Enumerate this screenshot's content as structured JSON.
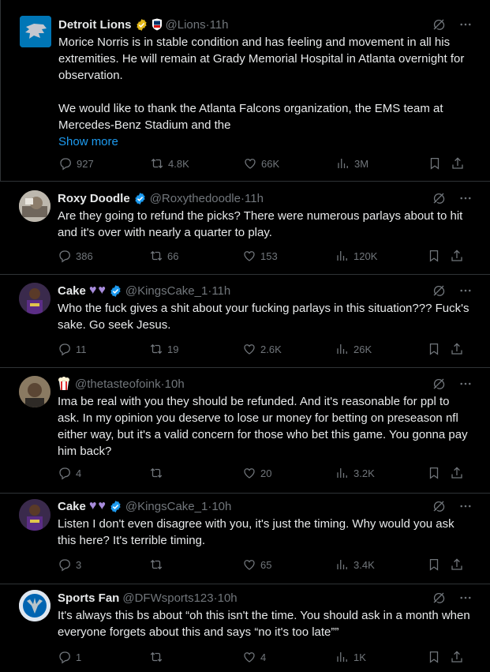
{
  "tweets": [
    {
      "name": "Detroit Lions",
      "handle": "@Lions",
      "time": "11h",
      "text": "Morice Norris is in stable condition and has feeling and movement in all his extremities. He will remain at Grady Memorial Hospital in Atlanta overnight for observation.\n\nWe would like to thank the Atlanta Falcons organization, the EMS team at Mercedes-Benz Stadium and the",
      "show_more": "Show more",
      "replies": "927",
      "reposts": "4.8K",
      "likes": "66K",
      "views": "3M",
      "badge": "gold-verified-badge"
    },
    {
      "name": "Roxy Doodle",
      "handle": "@Roxythedoodle",
      "time": "11h",
      "text": "Are they going to refund the picks? There were numerous parlays about to hit and it's over with nearly a quarter to play.",
      "replies": "386",
      "reposts": "66",
      "likes": "153",
      "views": "120K",
      "badge": "blue-verified-badge"
    },
    {
      "name": "Cake",
      "handle": "@KingsCake_1",
      "time": "11h",
      "text": "Who the fuck gives a shit about your fucking parlays in this situation??? Fuck's sake. Go seek Jesus.",
      "replies": "11",
      "reposts": "19",
      "likes": "2.6K",
      "views": "26K",
      "badge": "blue-verified-badge"
    },
    {
      "name": "",
      "handle": "@thetasteofoink",
      "time": "10h",
      "text": "Ima be real with you they should be refunded. And it's reasonable for ppl to ask. In my opinion you deserve to lose ur money for betting on preseason nfl either way, but it's a valid concern for those who bet this game. You gonna pay him back?",
      "replies": "4",
      "reposts": "",
      "likes": "20",
      "views": "3.2K"
    },
    {
      "name": "Cake",
      "handle": "@KingsCake_1",
      "time": "10h",
      "text": "Listen I don't even disagree with you, it's just the timing. Why would you ask this here? It's terrible timing.",
      "replies": "3",
      "reposts": "",
      "likes": "65",
      "views": "3.4K",
      "badge": "blue-verified-badge"
    },
    {
      "name": "Sports Fan",
      "handle": "@DFWsports123",
      "time": "10h",
      "text": "It's always this bs about “oh this isn't the time. You should ask in a month when everyone forgets about this and says “no it's too late””",
      "replies": "1",
      "reposts": "",
      "likes": "4",
      "views": "1K"
    }
  ],
  "separator": " · ",
  "colors": {
    "background": "#000000",
    "text": "#e7e9ea",
    "muted": "#71767b",
    "link": "#1d9bf0",
    "verified": "#1d9bf0",
    "gold": "#e2b719"
  }
}
